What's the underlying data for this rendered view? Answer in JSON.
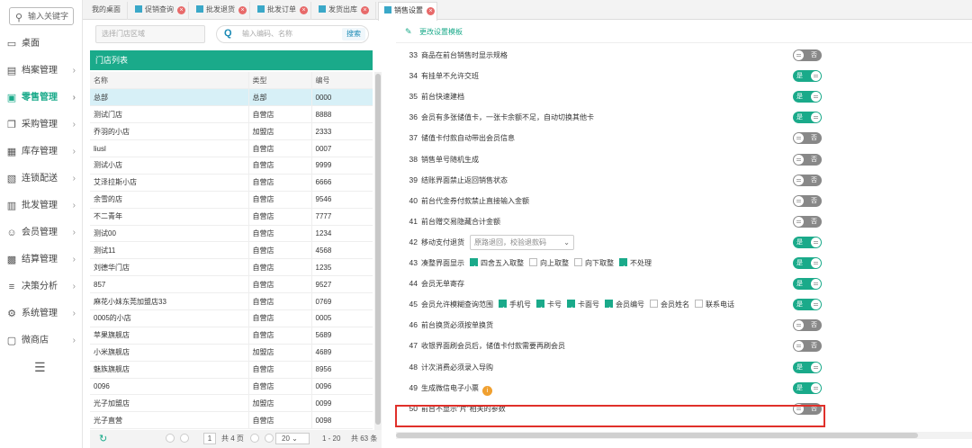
{
  "sidebar": {
    "search_placeholder": "输入关键字",
    "items": [
      {
        "label": "桌面",
        "icon": "desktop-icon",
        "arrow": ""
      },
      {
        "label": "档案管理",
        "icon": "archive-icon",
        "arrow": "›"
      },
      {
        "label": "零售管理",
        "icon": "retail-icon",
        "arrow": "›",
        "active": true
      },
      {
        "label": "采购管理",
        "icon": "purchase-icon",
        "arrow": "›"
      },
      {
        "label": "库存管理",
        "icon": "inventory-icon",
        "arrow": "›"
      },
      {
        "label": "连锁配送",
        "icon": "delivery-icon",
        "arrow": "›"
      },
      {
        "label": "批发管理",
        "icon": "wholesale-icon",
        "arrow": "›"
      },
      {
        "label": "会员管理",
        "icon": "member-icon",
        "arrow": "›"
      },
      {
        "label": "结算管理",
        "icon": "settlement-icon",
        "arrow": "›"
      },
      {
        "label": "决策分析",
        "icon": "analysis-icon",
        "arrow": "›"
      },
      {
        "label": "系统管理",
        "icon": "gear-icon",
        "arrow": "›"
      },
      {
        "label": "微商店",
        "icon": "shop-icon",
        "arrow": "›"
      }
    ]
  },
  "tabs": [
    {
      "label": "我的桌面",
      "closable": false
    },
    {
      "label": "促销查询",
      "closable": true
    },
    {
      "label": "批发退货",
      "closable": true
    },
    {
      "label": "批发订单",
      "closable": true
    },
    {
      "label": "发货出库",
      "closable": true
    },
    {
      "label": "销售设置",
      "closable": true,
      "active": true
    }
  ],
  "store": {
    "select_placeholder": "选择门店区域",
    "search_placeholder": "输入编码、名称",
    "search_button": "搜索",
    "list_title": "门店列表",
    "columns": [
      "名称",
      "类型",
      "编号"
    ],
    "rows": [
      [
        "总部",
        "总部",
        "0000"
      ],
      [
        "测试门店",
        "自营店",
        "8888"
      ],
      [
        "乔羽的小店",
        "加盟店",
        "2333"
      ],
      [
        "liusl",
        "自营店",
        "0007"
      ],
      [
        "测试小店",
        "自营店",
        "9999"
      ],
      [
        "艾泽拉斯小店",
        "自营店",
        "6666"
      ],
      [
        "余雪的店",
        "自营店",
        "9546"
      ],
      [
        "不二青年",
        "自营店",
        "7777"
      ],
      [
        "测试00",
        "自营店",
        "1234"
      ],
      [
        "测试11",
        "自营店",
        "4568"
      ],
      [
        "刘德华门店",
        "自营店",
        "1235"
      ],
      [
        "857",
        "自营店",
        "9527"
      ],
      [
        "麻花小妹东莞加盟店33",
        "自营店",
        "0769"
      ],
      [
        "0005的小店",
        "自营店",
        "0005"
      ],
      [
        "苹果旗舰店",
        "自营店",
        "5689"
      ],
      [
        "小米旗舰店",
        "加盟店",
        "4689"
      ],
      [
        "魅族旗舰店",
        "自营店",
        "8956"
      ],
      [
        "0096",
        "自营店",
        "0096"
      ],
      [
        "光子加盟店",
        "加盟店",
        "0099"
      ],
      [
        "光子直营",
        "自营店",
        "0098"
      ]
    ],
    "pager": {
      "page": "1",
      "total_pages_text": "共 4 页",
      "page_size": "20",
      "range_text": "1 - 20",
      "total_text": "共 63 条"
    }
  },
  "settings": {
    "edit_template_label": "更改设置模板",
    "on_label": "是",
    "off_label": "否",
    "rows": [
      {
        "num": "33",
        "text": "商品在前台销售时显示规格",
        "on": false
      },
      {
        "num": "34",
        "text": "有挂单不允许交班",
        "on": true
      },
      {
        "num": "35",
        "text": "前台快速建档",
        "on": true
      },
      {
        "num": "36",
        "text": "会员有多张储值卡，一张卡余额不足，自动切换其他卡",
        "on": true
      },
      {
        "num": "37",
        "text": "储值卡付款自动带出会员信息",
        "on": false
      },
      {
        "num": "38",
        "text": "销售单号随机生成",
        "on": false
      },
      {
        "num": "39",
        "text": "结账界面禁止返回销售状态",
        "on": false
      },
      {
        "num": "40",
        "text": "前台代金券付款禁止直接输入金额",
        "on": false
      },
      {
        "num": "41",
        "text": "前台赠交易隐藏合计金额",
        "on": false
      },
      {
        "num": "42",
        "text": "移动支付退货",
        "on": true,
        "select": "原路退回，校验退款码"
      },
      {
        "num": "43",
        "text": "凑整界面显示",
        "on": true,
        "checks": [
          {
            "label": "四舍五入取整",
            "checked": true
          },
          {
            "label": "向上取整",
            "checked": false
          },
          {
            "label": "向下取整",
            "checked": false
          },
          {
            "label": "不处理",
            "checked": true
          }
        ]
      },
      {
        "num": "44",
        "text": "会员无单寄存",
        "on": true
      },
      {
        "num": "45",
        "text": "会员允许模糊查询范围",
        "on": true,
        "checks": [
          {
            "label": "手机号",
            "checked": true
          },
          {
            "label": "卡号",
            "checked": true
          },
          {
            "label": "卡面号",
            "checked": true
          },
          {
            "label": "会员编号",
            "checked": true
          },
          {
            "label": "会员姓名",
            "checked": false
          },
          {
            "label": "联系电话",
            "checked": false
          }
        ]
      },
      {
        "num": "46",
        "text": "前台换货必须按单换货",
        "on": false
      },
      {
        "num": "47",
        "text": "收银界面刷会员后，储值卡付款需要再刷会员",
        "on": false
      },
      {
        "num": "48",
        "text": "计次消费必须录入导购",
        "on": true
      },
      {
        "num": "49",
        "text": "生成微信电子小票",
        "on": true,
        "info": "i"
      },
      {
        "num": "50",
        "text": "前台不显示\"片\"相关的参数",
        "on": false
      }
    ]
  },
  "colors": {
    "accent": "#1aaa8a",
    "highlight": "#e0302a",
    "toggle_off": "#888888"
  }
}
